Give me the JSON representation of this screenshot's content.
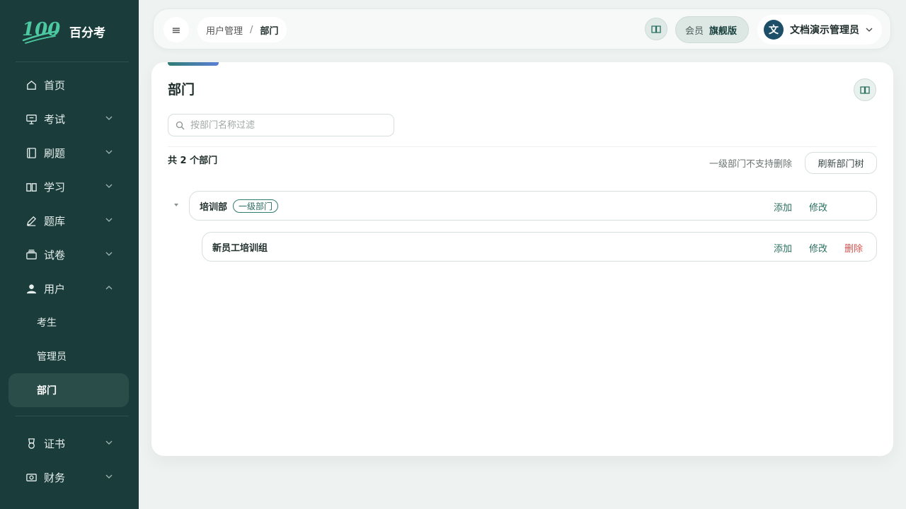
{
  "brand": {
    "logo_text": "100",
    "name": "百分考"
  },
  "sidebar": {
    "items": [
      {
        "label": "首页",
        "icon": "home-icon"
      },
      {
        "label": "考试",
        "icon": "presentation-icon"
      },
      {
        "label": "刷题",
        "icon": "notebook-icon"
      },
      {
        "label": "学习",
        "icon": "book-open-icon"
      },
      {
        "label": "题库",
        "icon": "pencil-icon"
      },
      {
        "label": "试卷",
        "icon": "paper-tray-icon"
      },
      {
        "label": "用户",
        "icon": "user-icon"
      }
    ],
    "user_sub": [
      "考生",
      "管理员",
      "部门"
    ],
    "bottom_items": [
      {
        "label": "证书",
        "icon": "medal-icon"
      },
      {
        "label": "财务",
        "icon": "money-icon"
      }
    ]
  },
  "header": {
    "breadcrumb": [
      "用户管理",
      "部门"
    ],
    "breadcrumb_sep": "/",
    "member_label": "会员",
    "member_plan": "旗舰版",
    "avatar_letter": "文",
    "user_name": "文档演示管理员"
  },
  "page": {
    "title": "部门",
    "search_placeholder": "按部门名称过滤",
    "count_text": "共 2 个部门",
    "note": "一级部门不支持删除",
    "refresh_label": "刷新部门树",
    "nodes": [
      {
        "name": "培训部",
        "tag": "一级部门",
        "actions": [
          "添加",
          "修改"
        ]
      },
      {
        "name": "新员工培训组",
        "actions": [
          "添加",
          "修改",
          "删除"
        ]
      }
    ]
  },
  "colors": {
    "sidebar_bg": "#1a3c3a",
    "accent": "#2a6f5f",
    "danger": "#d9534f"
  }
}
